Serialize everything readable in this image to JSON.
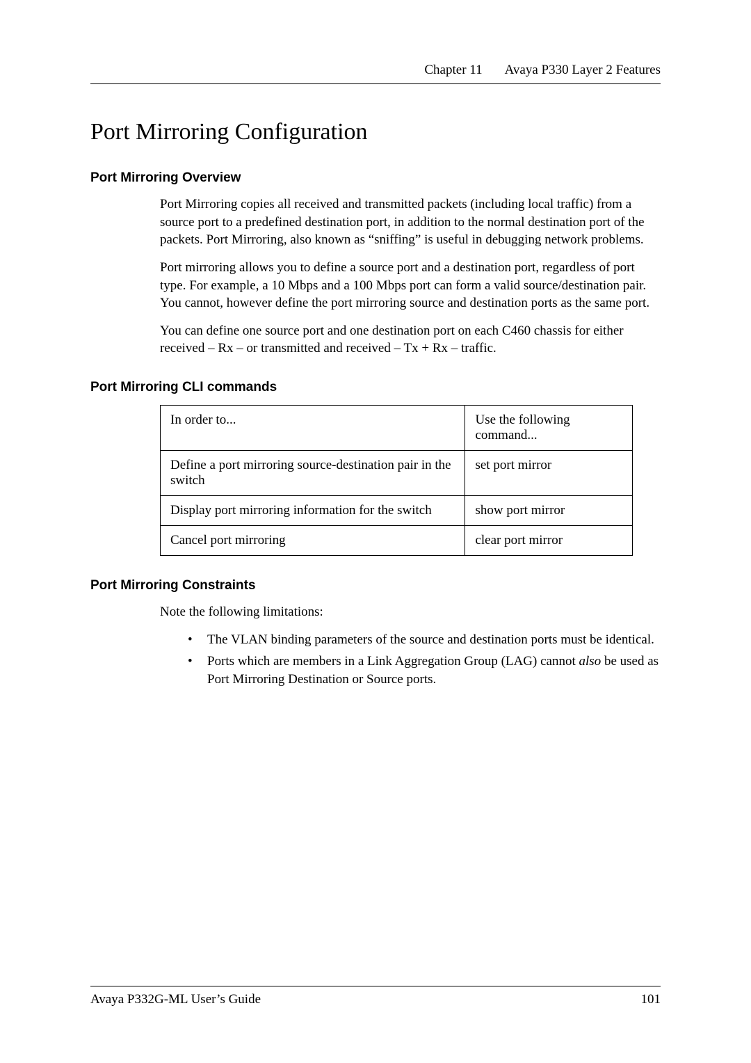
{
  "running_head": {
    "chapter": "Chapter 11",
    "title": "Avaya P330 Layer 2 Features"
  },
  "h1": "Port Mirroring Configuration",
  "overview": {
    "heading": "Port Mirroring Overview",
    "p1": "Port Mirroring copies all received and transmitted packets (including local traffic) from a source port to a predefined destination port, in addition to the normal destination port of the packets. Port Mirroring, also known as “sniffing” is useful in debugging network problems.",
    "p2": "Port mirroring allows you to define a source port and a destination port, regardless of port type. For example, a 10 Mbps and a 100 Mbps port can form a valid source/destination pair. You cannot, however define the port mirroring source and destination ports as the same port.",
    "p3": "You can define one source port and one destination port on each C460 chassis for either received – Rx – or transmitted and received – Tx + Rx – traffic."
  },
  "cli": {
    "heading": "Port Mirroring CLI commands",
    "header": {
      "c1": "In order to...",
      "c2": "Use the following command..."
    },
    "rows": [
      {
        "c1": "Define a port mirroring source-destination pair in the switch",
        "c2": "set port mirror"
      },
      {
        "c1": "Display port mirroring information for the switch",
        "c2": "show port mirror"
      },
      {
        "c1": "Cancel port mirroring",
        "c2": "clear port mirror"
      }
    ]
  },
  "constraints": {
    "heading": "Port Mirroring Constraints",
    "intro": "Note the following limitations:",
    "b1_pre": "The VLAN binding parameters of the source and destination ports must be identical.",
    "b2_pre": "Ports which are members in a Link Aggregation Group (LAG) cannot ",
    "b2_em": "also",
    "b2_post": " be used as Port Mirroring Destination or Source ports."
  },
  "footer": {
    "left": "Avaya P332G-ML User’s Guide",
    "right": "101"
  }
}
